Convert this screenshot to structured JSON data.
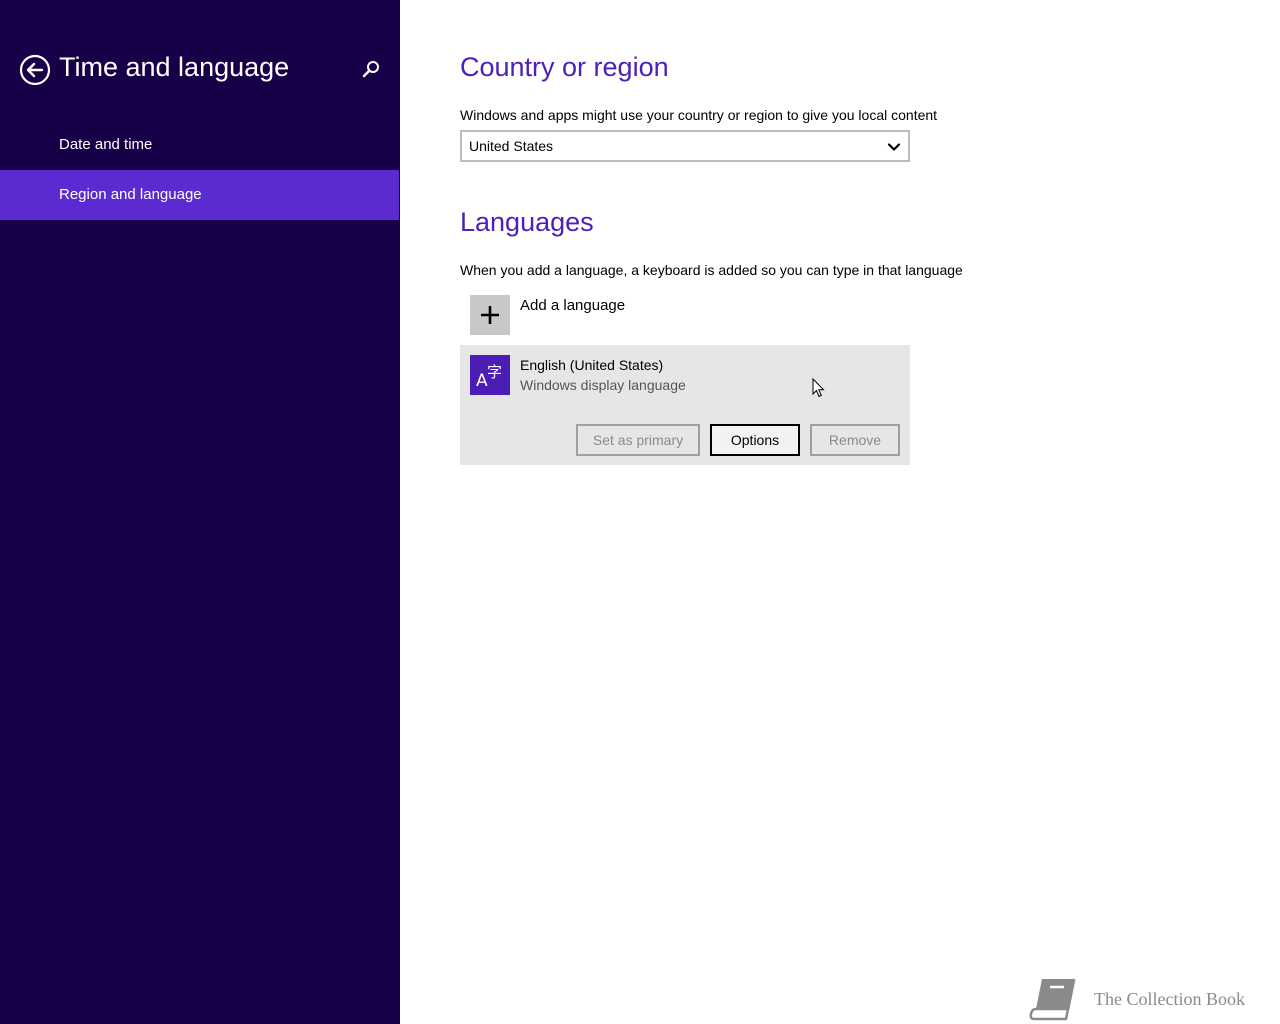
{
  "sidebar": {
    "title": "Time and language",
    "back_icon": "back-arrow-icon",
    "search_icon": "search-icon",
    "items": [
      {
        "label": "Date and time",
        "selected": false
      },
      {
        "label": "Region and language",
        "selected": true
      }
    ]
  },
  "country": {
    "heading": "Country or region",
    "description": "Windows and apps might use your country or region to give you local content",
    "selected_value": "United States"
  },
  "languages": {
    "heading": "Languages",
    "description": "When you add a language, a keyboard is added so you can type in that language",
    "add_label": "Add a language",
    "items": [
      {
        "name": "English (United States)",
        "status": "Windows display language",
        "buttons": {
          "set_primary": "Set as primary",
          "options": "Options",
          "remove": "Remove"
        }
      }
    ]
  },
  "watermark": {
    "text": "The Collection Book"
  },
  "colors": {
    "sidebar_bg": "#180048",
    "selected_bg": "#5c2ad1",
    "accent": "#4f20b8"
  }
}
